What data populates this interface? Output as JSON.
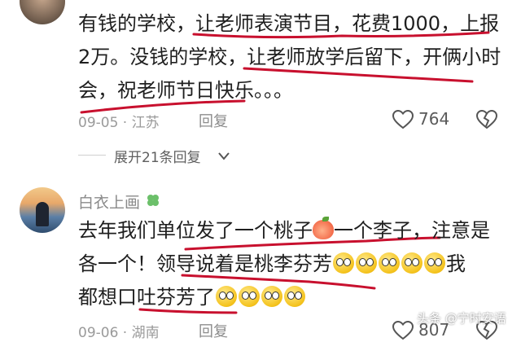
{
  "comment1": {
    "lines": [
      "有钱的学校，让老师表演节目，花费1000，上报",
      "2万。没钱的学校，让老师放学后留下，开俩小时",
      "会，祝老师节日快乐。。。"
    ],
    "date_location": "09-05 · 江苏",
    "reply_label": "回复",
    "likes": "764",
    "expand_replies": "展开21条回复"
  },
  "comment2": {
    "username": "白衣上画",
    "line1_a": "去年我们单位发了一个桃子",
    "line1_b": "一个李子，注意是",
    "line2": "各一个！领导说着是桃李芬芳",
    "line2_end": "我",
    "line3": "都想口吐芬芳了",
    "date_location": "09-06 · 湖南",
    "reply_label": "回复",
    "likes": "807"
  },
  "watermark": "头条 @宁时安语",
  "colors": {
    "underline_red": "#c8102e",
    "clover_green": "#6cc06a"
  },
  "icons": [
    "heart-icon",
    "broken-heart-icon",
    "chevron-down-icon",
    "clover-icon"
  ]
}
